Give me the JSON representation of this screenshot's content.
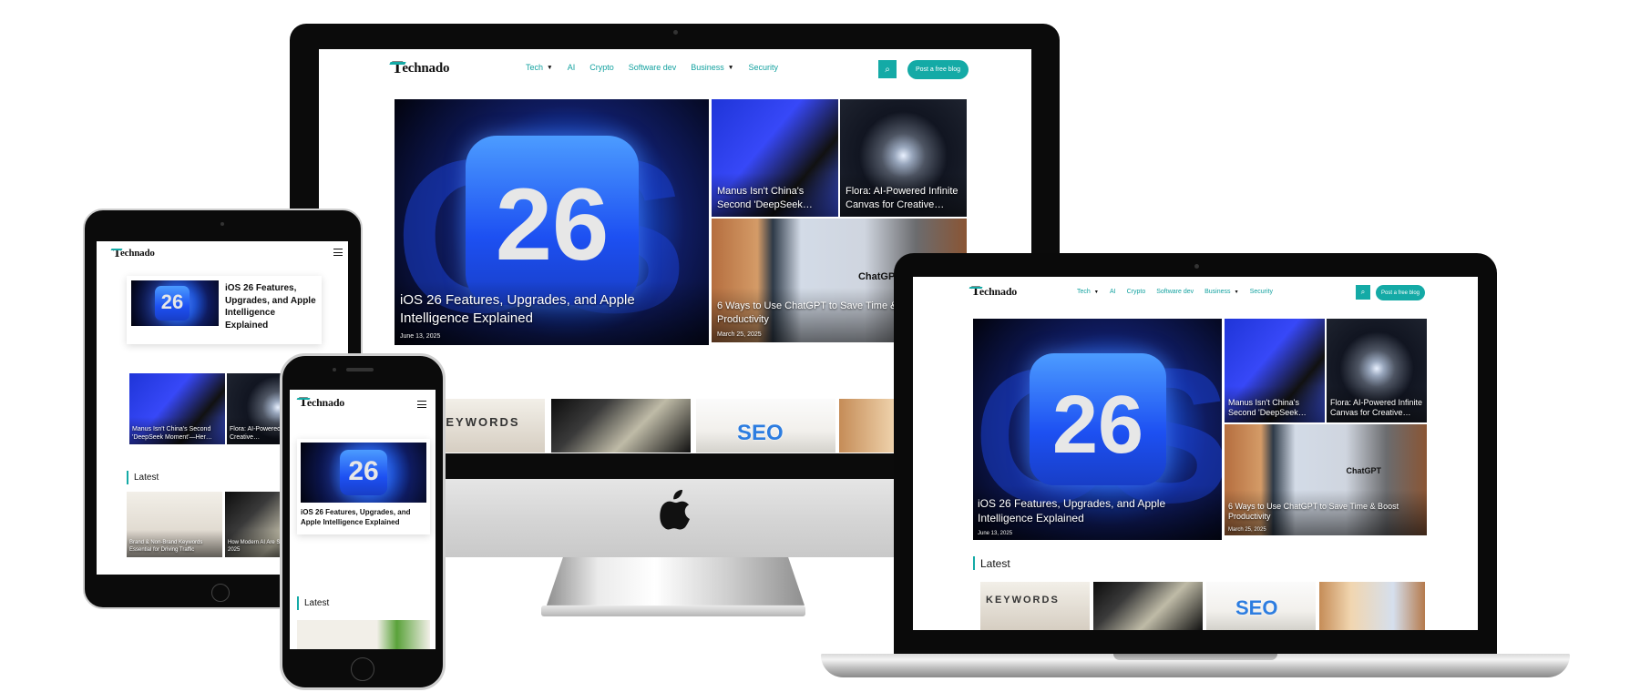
{
  "brand": {
    "mark": "T",
    "rest": "echnado"
  },
  "nav": {
    "items": [
      "Tech",
      "AI",
      "Crypto",
      "Software dev",
      "Business",
      "Security"
    ],
    "cta": "Post a free blog"
  },
  "hero": {
    "number": "26",
    "title": "iOS 26 Features, Upgrades, and Apple Intelligence Explained",
    "date": "June 13, 2025"
  },
  "side_cards": [
    {
      "title": "Manus Isn't China's Second 'DeepSeek…"
    },
    {
      "title": "Flora: AI-Powered Infinite Canvas for Creative…"
    },
    {
      "title": "6 Ways to Use ChatGPT to Save Time & Boost Productivity",
      "date": "March 25, 2025",
      "label": "ChatGPT"
    }
  ],
  "latest": {
    "heading": "Latest",
    "items": [
      {
        "title": "Brand & Non-Brand Keywords Essential for Driving Traffic"
      },
      {
        "title": "How Modern AI Are Saving Money in 2025"
      }
    ],
    "seo_text": "SEO",
    "keyword_text": "KEYWORDS"
  },
  "tablet": {
    "feature_title": "iOS 26 Features, Upgrades, and Apple Intelligence Explained",
    "side_titles": [
      "Manus Isn't China's Second 'DeepSeek Moment'—Her…",
      "Flora: AI-Powered Canvas for Creative…"
    ]
  },
  "phone": {
    "feature_title": "iOS 26 Features, Upgrades, and Apple Intelligence Explained"
  },
  "colors": {
    "accent": "#14aaa6",
    "nav_text": "#14a2a0"
  },
  "icons": [
    "search-icon",
    "menu-icon",
    "apple-logo-icon",
    "dropdown-caret-icon"
  ]
}
